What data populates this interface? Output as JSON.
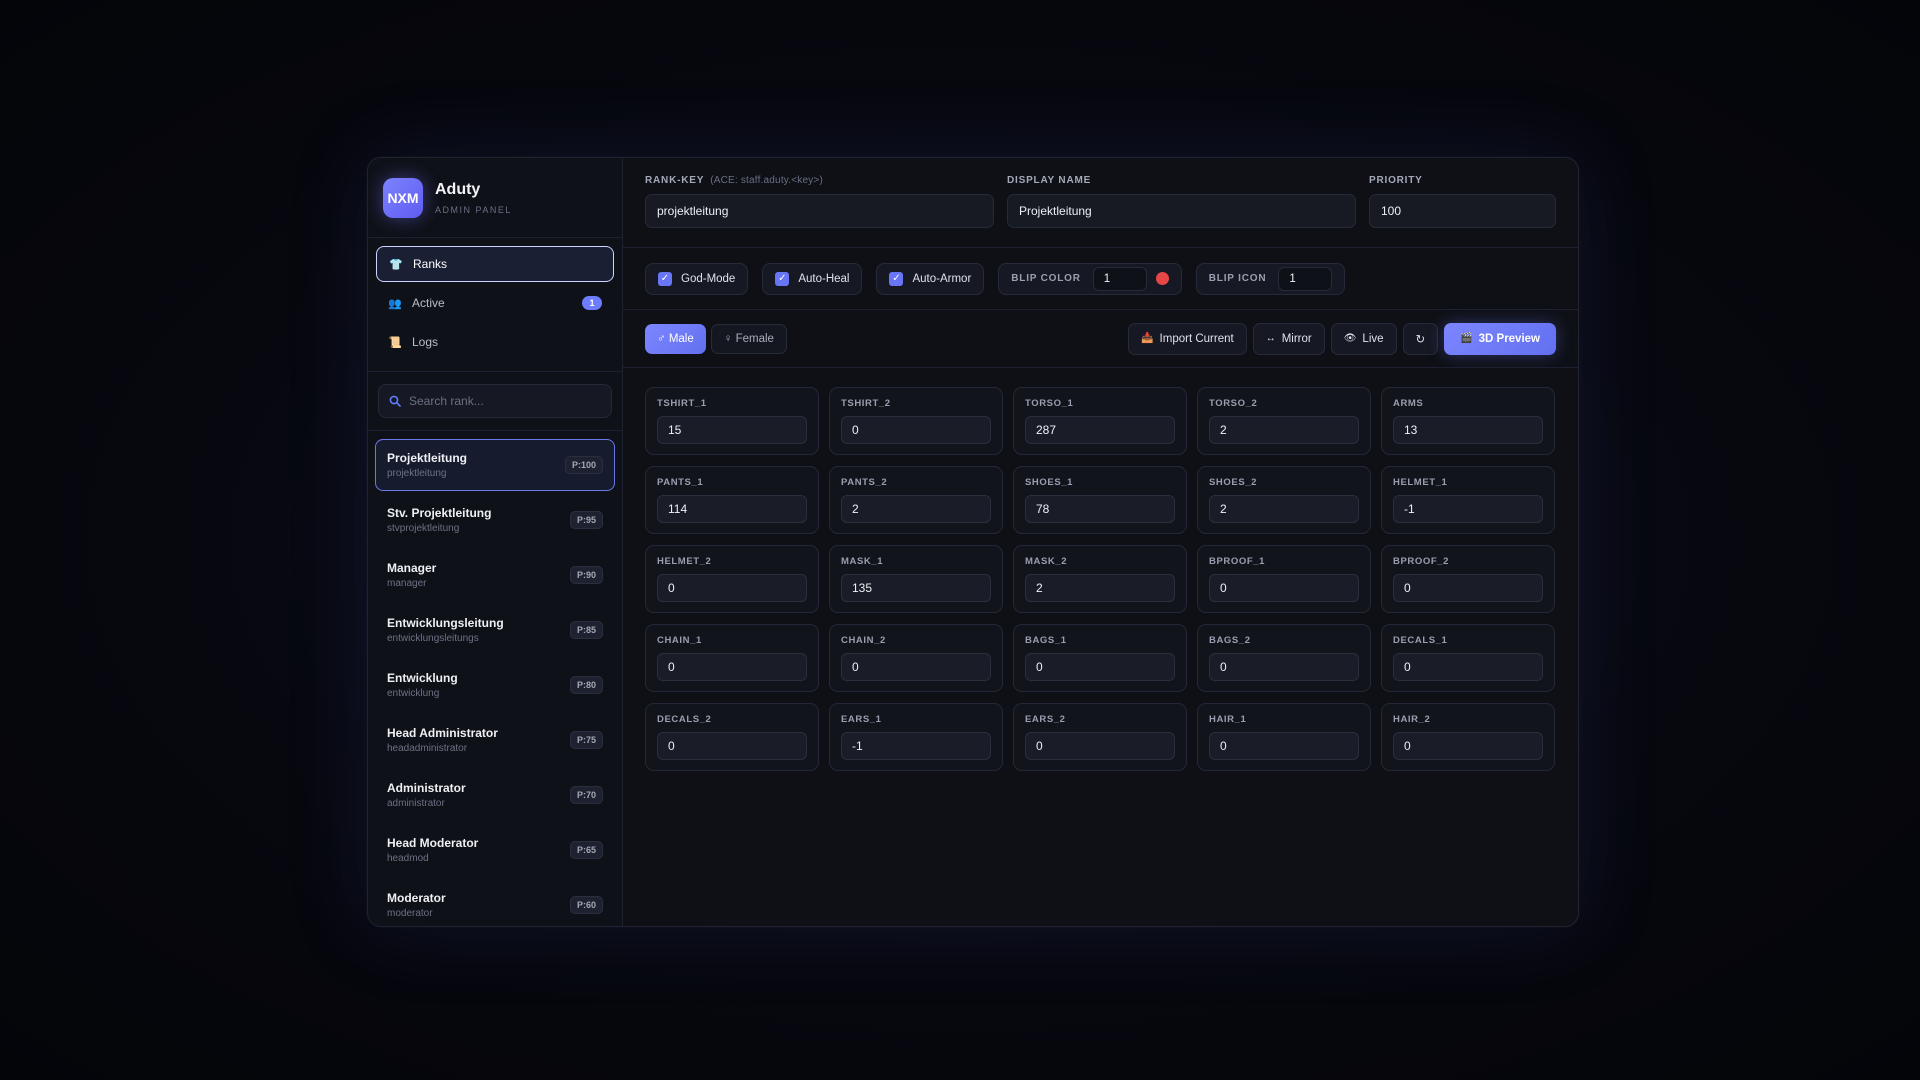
{
  "brand": {
    "logo": "NXM",
    "title": "Aduty",
    "subtitle": "ADMIN PANEL"
  },
  "nav": [
    {
      "label": "Ranks",
      "icon": "shirt-icon",
      "glyph": "👕",
      "active": true
    },
    {
      "label": "Active",
      "icon": "users-icon",
      "glyph": "👥",
      "badge": "1"
    },
    {
      "label": "Logs",
      "icon": "scroll-icon",
      "glyph": "📜"
    }
  ],
  "search": {
    "placeholder": "Search rank..."
  },
  "ranks": [
    {
      "name": "Projektleitung",
      "key": "projektleitung",
      "prio": "P:100",
      "active": true
    },
    {
      "name": "Stv. Projektleitung",
      "key": "stvprojektleitung",
      "prio": "P:95"
    },
    {
      "name": "Manager",
      "key": "manager",
      "prio": "P:90"
    },
    {
      "name": "Entwicklungsleitung",
      "key": "entwicklungsleitungs",
      "prio": "P:85"
    },
    {
      "name": "Entwicklung",
      "key": "entwicklung",
      "prio": "P:80"
    },
    {
      "name": "Head Administrator",
      "key": "headadministrator",
      "prio": "P:75"
    },
    {
      "name": "Administrator",
      "key": "administrator",
      "prio": "P:70"
    },
    {
      "name": "Head Moderator",
      "key": "headmod",
      "prio": "P:65"
    },
    {
      "name": "Moderator",
      "key": "moderator",
      "prio": "P:60"
    }
  ],
  "fields": {
    "rank_key": {
      "label": "RANK-KEY",
      "hint": "(ACE: staff.aduty.<key>)",
      "value": "projektleitung"
    },
    "display_name": {
      "label": "DISPLAY NAME",
      "value": "Projektleitung"
    },
    "priority": {
      "label": "PRIORITY",
      "value": "100"
    }
  },
  "options": {
    "god_mode": "God-Mode",
    "auto_heal": "Auto-Heal",
    "auto_armor": "Auto-Armor",
    "blip_color": {
      "label": "BLIP COLOR",
      "value": "1",
      "swatch": "#e64646"
    },
    "blip_icon": {
      "label": "BLIP ICON",
      "value": "1"
    }
  },
  "gender": {
    "male": "♂ Male",
    "female": "♀ Female"
  },
  "toolbar": {
    "import": "Import Current",
    "mirror": "Mirror",
    "live": "Live",
    "reset": "↻",
    "preview": "3D Preview"
  },
  "clothing": [
    {
      "label": "TSHIRT_1",
      "value": "15"
    },
    {
      "label": "TSHIRT_2",
      "value": "0"
    },
    {
      "label": "TORSO_1",
      "value": "287"
    },
    {
      "label": "TORSO_2",
      "value": "2"
    },
    {
      "label": "ARMS",
      "value": "13"
    },
    {
      "label": "PANTS_1",
      "value": "114"
    },
    {
      "label": "PANTS_2",
      "value": "2"
    },
    {
      "label": "SHOES_1",
      "value": "78"
    },
    {
      "label": "SHOES_2",
      "value": "2"
    },
    {
      "label": "HELMET_1",
      "value": "-1"
    },
    {
      "label": "HELMET_2",
      "value": "0"
    },
    {
      "label": "MASK_1",
      "value": "135"
    },
    {
      "label": "MASK_2",
      "value": "2"
    },
    {
      "label": "BPROOF_1",
      "value": "0"
    },
    {
      "label": "BPROOF_2",
      "value": "0"
    },
    {
      "label": "CHAIN_1",
      "value": "0"
    },
    {
      "label": "CHAIN_2",
      "value": "0"
    },
    {
      "label": "BAGS_1",
      "value": "0"
    },
    {
      "label": "BAGS_2",
      "value": "0"
    },
    {
      "label": "DECALS_1",
      "value": "0"
    },
    {
      "label": "DECALS_2",
      "value": "0"
    },
    {
      "label": "EARS_1",
      "value": "-1"
    },
    {
      "label": "EARS_2",
      "value": "0"
    },
    {
      "label": "HAIR_1",
      "value": "0"
    },
    {
      "label": "HAIR_2",
      "value": "0"
    }
  ]
}
